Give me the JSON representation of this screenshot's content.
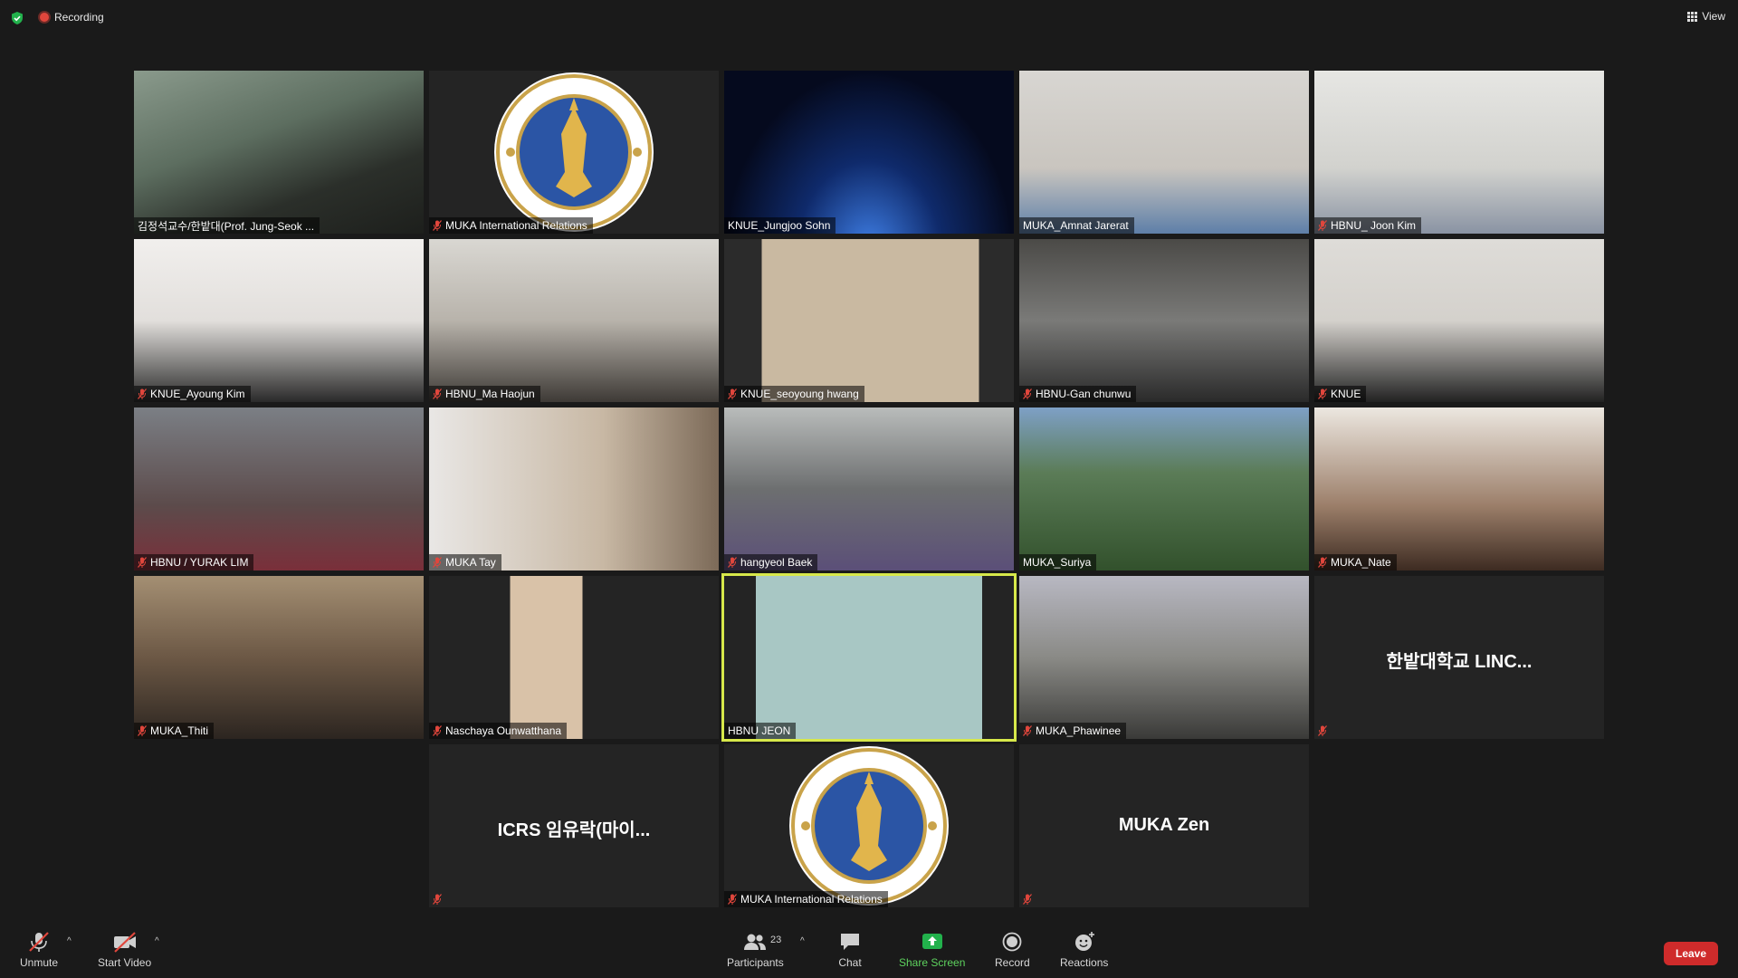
{
  "window": {
    "recording_label": "Recording",
    "view_label": "View"
  },
  "tiles": [
    {
      "name": "김정석교수/한밭대(Prof. Jung-Seok ...",
      "muted": false,
      "type": "video"
    },
    {
      "name": "MUKA International Relations",
      "muted": true,
      "type": "logo"
    },
    {
      "name": "KNUE_Jungjoo Sohn",
      "muted": false,
      "type": "video"
    },
    {
      "name": "MUKA_Amnat Jarerat",
      "muted": false,
      "type": "video"
    },
    {
      "name": "HBNU_ Joon Kim",
      "muted": true,
      "type": "video"
    },
    {
      "name": "KNUE_Ayoung Kim",
      "muted": true,
      "type": "video"
    },
    {
      "name": "HBNU_Ma Haojun",
      "muted": true,
      "type": "video"
    },
    {
      "name": "KNUE_seoyoung hwang",
      "muted": true,
      "type": "video"
    },
    {
      "name": "HBNU-Gan chunwu",
      "muted": true,
      "type": "video"
    },
    {
      "name": "KNUE",
      "muted": true,
      "type": "video"
    },
    {
      "name": "HBNU / YURAK LIM",
      "muted": true,
      "type": "video"
    },
    {
      "name": "MUKA Tay",
      "muted": true,
      "type": "video"
    },
    {
      "name": "hangyeol Baek",
      "muted": true,
      "type": "video"
    },
    {
      "name": "MUKA_Suriya",
      "muted": false,
      "type": "video"
    },
    {
      "name": "MUKA_Nate",
      "muted": true,
      "type": "video"
    },
    {
      "name": "MUKA_Thiti",
      "muted": true,
      "type": "video"
    },
    {
      "name": "Naschaya Ounwatthana",
      "muted": true,
      "type": "video"
    },
    {
      "name": "HBNU JEON",
      "muted": false,
      "type": "video",
      "active": true
    },
    {
      "name": "MUKA_Phawinee",
      "muted": true,
      "type": "video"
    },
    {
      "name": "",
      "big_name": "한밭대학교 LINC...",
      "muted": true,
      "type": "name-only"
    },
    {
      "name": "",
      "big_name": "ICRS 임유락(마이...",
      "muted": true,
      "type": "name-only"
    },
    {
      "name": "MUKA International Relations",
      "muted": true,
      "type": "logo"
    },
    {
      "name": "",
      "big_name": "MUKA Zen",
      "muted": true,
      "type": "name-only"
    }
  ],
  "toolbar": {
    "unmute_label": "Unmute",
    "start_video_label": "Start Video",
    "participants_label": "Participants",
    "participants_count": "23",
    "chat_label": "Chat",
    "share_screen_label": "Share Screen",
    "record_label": "Record",
    "reactions_label": "Reactions",
    "leave_label": "Leave"
  },
  "colors": {
    "active_speaker_border": "#d7e84a",
    "share_green": "#5ed25e",
    "leave_red": "#cf2b2b",
    "record_red": "#e0463c"
  }
}
